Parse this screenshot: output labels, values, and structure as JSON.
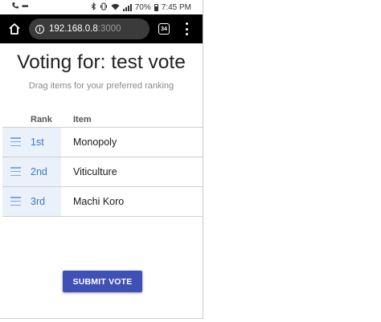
{
  "status_bar": {
    "battery_percent": "70%",
    "time": "7:45 PM",
    "left_icons": [
      "phone-call-icon",
      "more-dots-icon"
    ],
    "right_icons": [
      "bluetooth-icon",
      "vibrate-icon",
      "wifi-icon",
      "signal-icon",
      "battery-icon"
    ]
  },
  "browser": {
    "url_host": "192.168.0.8",
    "url_port": ":3000",
    "tab_count": "34",
    "icons": [
      "home-icon",
      "info-icon",
      "tabs-icon",
      "overflow-menu-icon"
    ]
  },
  "page": {
    "title": "Voting for: test vote",
    "subtitle": "Drag items for your preferred ranking",
    "columns": {
      "rank": "Rank",
      "item": "Item"
    },
    "rows": [
      {
        "rank": "1st",
        "item": "Monopoly"
      },
      {
        "rank": "2nd",
        "item": "Viticulture"
      },
      {
        "rank": "3rd",
        "item": "Machi Koro"
      }
    ],
    "submit_label": "SUBMIT VOTE"
  },
  "colors": {
    "accent": "#3f51b5",
    "rank_text": "#3d79c2",
    "handle_cell_bg": "#eaf1fb",
    "browser_bar": "#000000"
  }
}
